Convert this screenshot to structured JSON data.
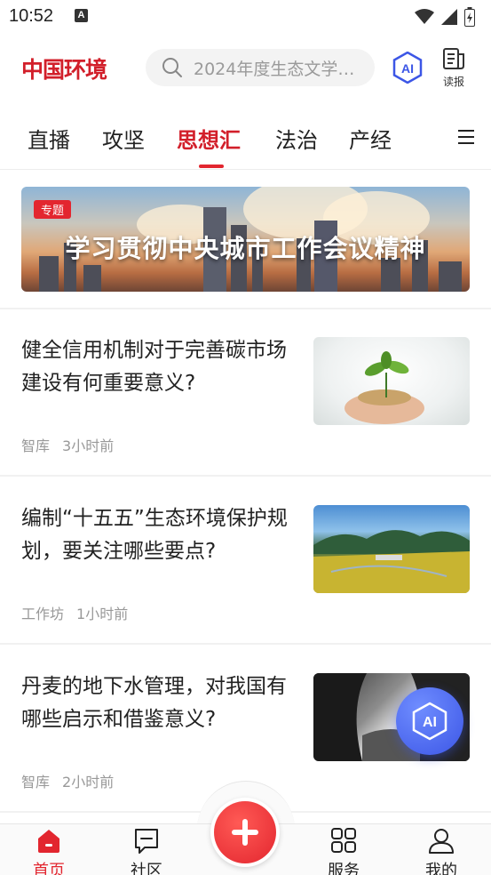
{
  "status_bar": {
    "time": "10:52",
    "notification_badge": "A"
  },
  "header": {
    "logo": "中国环境",
    "search": {
      "placeholder": "2024年度生态文学…"
    },
    "ai_label": "AI",
    "read_label": "读报"
  },
  "tabs": {
    "items": [
      {
        "label": "直播",
        "active": false
      },
      {
        "label": "攻坚",
        "active": false
      },
      {
        "label": "思想汇",
        "active": true
      },
      {
        "label": "法治",
        "active": false
      },
      {
        "label": "产经",
        "active": false
      }
    ]
  },
  "banner": {
    "tag": "专题",
    "title": "学习贯彻中央城市工作会议精神"
  },
  "articles": [
    {
      "title": "健全信用机制对于完善碳市场建设有何重要意义?",
      "source": "智库",
      "time": "3小时前",
      "thumb_icon": "seedling-in-hands-photo"
    },
    {
      "title": "编制“十五五”生态环境保护规划，要关注哪些要点?",
      "source": "工作坊",
      "time": "1小时前",
      "thumb_icon": "valley-farmland-photo"
    },
    {
      "title": "丹麦的地下水管理，对我国有哪些启示和借鉴意义?",
      "source": "智库",
      "time": "2小时前",
      "thumb_icon": "cave-landscape-photo"
    }
  ],
  "float_ai": {
    "label": "AI"
  },
  "bottom_nav": {
    "items": [
      {
        "label": "首页",
        "icon": "home-icon",
        "active": true
      },
      {
        "label": "社区",
        "icon": "chat-icon",
        "active": false
      },
      {
        "label": "服务",
        "icon": "grid-icon",
        "active": false
      },
      {
        "label": "我的",
        "icon": "user-icon",
        "active": false
      }
    ]
  },
  "colors": {
    "brand_red": "#e2262f",
    "ai_blue": "#3c56e6"
  }
}
